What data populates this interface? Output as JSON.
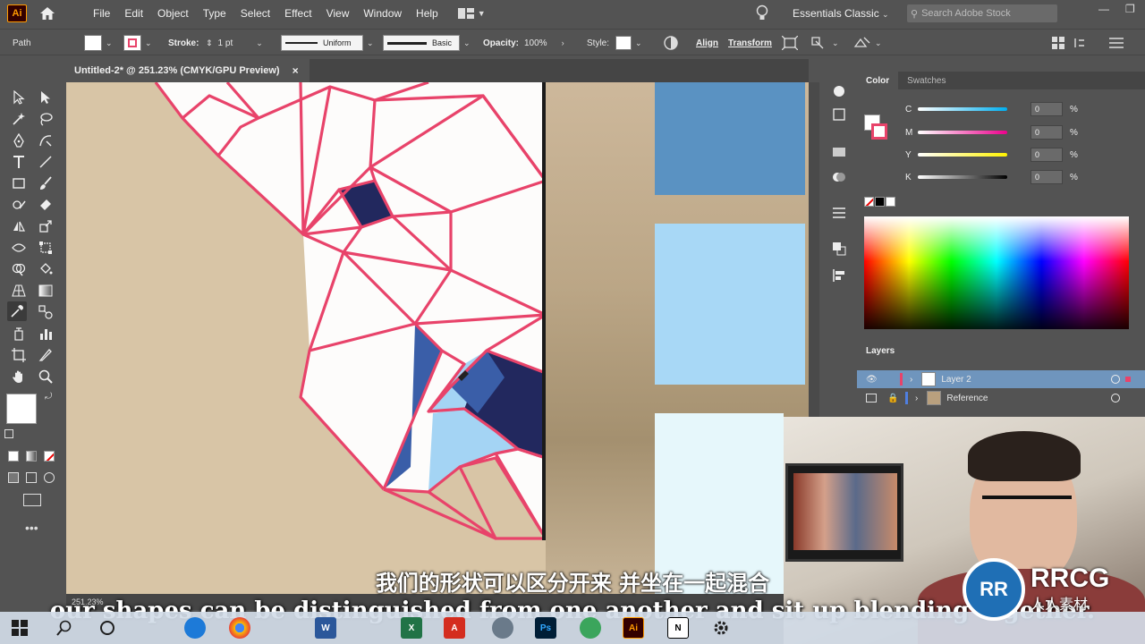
{
  "app": {
    "logo": "Ai"
  },
  "menu": [
    "File",
    "Edit",
    "Object",
    "Type",
    "Select",
    "Effect",
    "View",
    "Window",
    "Help"
  ],
  "workspace": "Essentials Classic",
  "search": {
    "placeholder": "Search Adobe Stock"
  },
  "control_bar": {
    "selection_type": "Path",
    "stroke_label": "Stroke:",
    "stroke_weight": "1 pt",
    "profile": "Uniform",
    "brush": "Basic",
    "opacity_label": "Opacity:",
    "opacity_value": "100%",
    "style_label": "Style:",
    "align_label": "Align",
    "transform_label": "Transform"
  },
  "document_tab": {
    "title": "Untitled-2* @ 251.23% (CMYK/GPU Preview)",
    "close": "×"
  },
  "status": {
    "zoom": "251.23%"
  },
  "color_panel": {
    "tabs": [
      "Color",
      "Swatches"
    ],
    "sliders": [
      {
        "label": "C",
        "value": "0",
        "unit": "%",
        "color": "#00aeef"
      },
      {
        "label": "M",
        "value": "0",
        "unit": "%",
        "color": "#ec008c"
      },
      {
        "label": "Y",
        "value": "0",
        "unit": "%",
        "color": "#fff200"
      },
      {
        "label": "K",
        "value": "0",
        "unit": "%",
        "color": "#000000"
      }
    ]
  },
  "layers_panel": {
    "title": "Layers",
    "layers": [
      {
        "name": "Layer 2",
        "color": "#e8436a",
        "selected": true
      },
      {
        "name": "Reference",
        "color": "#4f7fe0",
        "selected": false
      }
    ]
  },
  "colors": {
    "accent_pink": "#e8436a",
    "navy": "#22285e",
    "mid_blue": "#3a5ea8",
    "light_blue": "#a4d4f4",
    "swatch_blue": "#5a92c2",
    "swatch_sky": "#a8d8f6",
    "swatch_ice": "#e6f7fb"
  },
  "subtitles": {
    "chinese": "我们的形状可以区分开来 并坐在一起混合",
    "english": "our shapes can be distinguished from one another and sit up blending together."
  },
  "watermark": {
    "brand": "RRCG",
    "sub": "人人素材"
  },
  "taskbar": [
    "windows-start",
    "search",
    "cortana",
    "edge",
    "chrome",
    "word",
    "excel",
    "acrobat",
    "explorer",
    "browser",
    "photoshop",
    "browser2",
    "illustrator",
    "notion",
    "settings"
  ]
}
